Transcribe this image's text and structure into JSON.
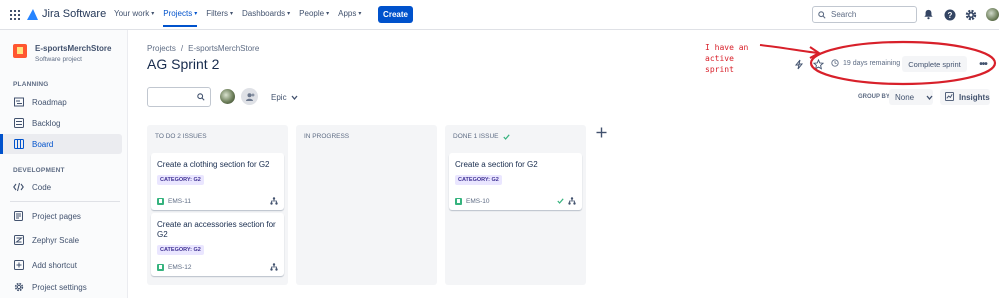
{
  "topnav": {
    "product": "Jira Software",
    "items": [
      {
        "label": "Your work",
        "active": false
      },
      {
        "label": "Projects",
        "active": true
      },
      {
        "label": "Filters",
        "active": false
      },
      {
        "label": "Dashboards",
        "active": false
      },
      {
        "label": "People",
        "active": false
      },
      {
        "label": "Apps",
        "active": false
      }
    ],
    "create_label": "Create",
    "search_placeholder": "Search",
    "icons": [
      "notifications-icon",
      "help-icon",
      "settings-icon",
      "avatar"
    ],
    "accent_color": "#0052cc"
  },
  "sidebar": {
    "project_name": "E-sportsMerchStore",
    "project_type": "Software project",
    "planning_header": "PLANNING",
    "planning_items": [
      {
        "label": "Roadmap",
        "icon": "roadmap-icon",
        "active": false
      },
      {
        "label": "Backlog",
        "icon": "backlog-icon",
        "active": false
      },
      {
        "label": "Board",
        "icon": "board-icon",
        "active": true
      }
    ],
    "development_header": "DEVELOPMENT",
    "development_items": [
      {
        "label": "Code",
        "icon": "code-icon"
      }
    ],
    "bottom_items": [
      {
        "label": "Project pages",
        "icon": "pages-icon"
      },
      {
        "label": "Zephyr Scale",
        "icon": "zephyr-icon"
      },
      {
        "label": "Add shortcut",
        "icon": "add-shortcut-icon"
      },
      {
        "label": "Project settings",
        "icon": "settings-icon"
      }
    ]
  },
  "header": {
    "breadcrumb": [
      "Projects",
      "E-sportsMerchStore"
    ],
    "breadcrumb_separator": "/",
    "title": "AG Sprint 2",
    "days_remaining": "19 days remaining",
    "complete_sprint_label": "Complete sprint",
    "more_label": "•••"
  },
  "annotation": {
    "text_line1": "I have an",
    "text_line2": "active sprint",
    "color": "#d8202a"
  },
  "filters": {
    "epic_label": "Epic",
    "group_by_label": "GROUP BY",
    "group_by_value": "None",
    "insights_label": "Insights"
  },
  "board": {
    "columns": [
      {
        "title": "TO DO 2 ISSUES",
        "cards": [
          {
            "title": "Create a clothing section for G2",
            "label": "CATEGORY: G2",
            "key": "EMS-11",
            "done": false
          },
          {
            "title": "Create an accessories section for G2",
            "label": "CATEGORY: G2",
            "key": "EMS-12",
            "done": false
          }
        ]
      },
      {
        "title": "IN PROGRESS",
        "cards": []
      },
      {
        "title": "DONE 1 ISSUE",
        "cards": [
          {
            "title": "Create a section for G2",
            "label": "CATEGORY: G2",
            "key": "EMS-10",
            "done": true
          }
        ]
      }
    ]
  }
}
